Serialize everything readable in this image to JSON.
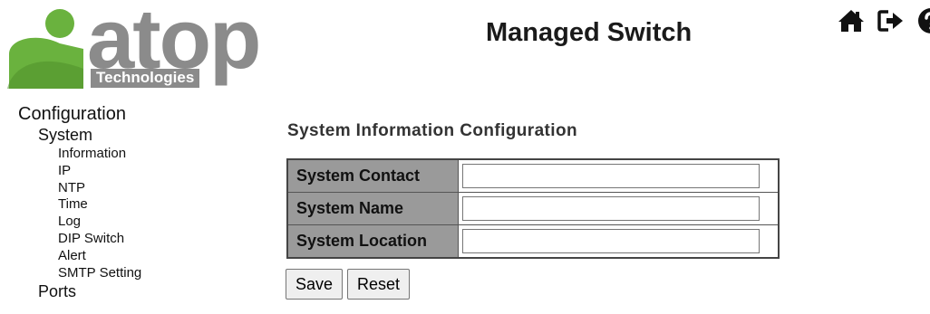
{
  "logo": {
    "brand": "atop",
    "sub": "Technologies"
  },
  "header": {
    "title": "Managed Switch"
  },
  "top_icons": [
    "home-icon",
    "logout-icon",
    "help-icon"
  ],
  "nav": {
    "configuration": "Configuration",
    "system": "System",
    "system_items": [
      "Information",
      "IP",
      "NTP",
      "Time",
      "Log",
      "DIP Switch",
      "Alert",
      "SMTP Setting"
    ],
    "ports": "Ports"
  },
  "main": {
    "title": "System Information Configuration",
    "fields": [
      {
        "label": "System Contact",
        "value": ""
      },
      {
        "label": "System Name",
        "value": ""
      },
      {
        "label": "System Location",
        "value": ""
      }
    ],
    "save_label": "Save",
    "reset_label": "Reset"
  },
  "colors": {
    "logo_gray": "#8b8b8b",
    "logo_green": "#6ab23e",
    "label_bg": "#9a9a9a"
  }
}
